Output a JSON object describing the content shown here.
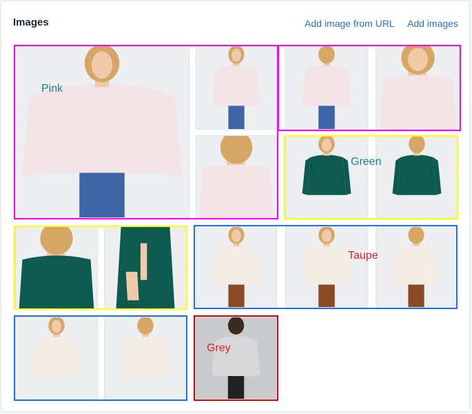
{
  "header": {
    "title": "Images",
    "add_from_url": "Add image from URL",
    "add_images": "Add images"
  },
  "groups": {
    "pink": {
      "label": "Pink",
      "label_color": "#1a7f8a",
      "border_color": "#ff00ff"
    },
    "green": {
      "label": "Green",
      "label_color": "#1a7f8a",
      "border_color": "#ffff00"
    },
    "taupe": {
      "label": "Taupe",
      "label_color": "#e02020",
      "border_color": "#1a73e8"
    },
    "grey": {
      "label": "Grey",
      "label_color": "#e02020",
      "border_color": "#e00000"
    }
  },
  "colors": {
    "pink_top": "#f1e3e6",
    "green_top": "#0d5b4f",
    "taupe_top": "#f3ede6",
    "grey_top": "#d8d8d8",
    "jeans": "#3d66a8",
    "brown_pants": "#8a4b24",
    "black_pants": "#222222",
    "skin": "#f0c9a8",
    "hair_blonde": "#d6a664",
    "hair_dark": "#3a2a22",
    "background_light": "#eceef0",
    "background_grey": "#c9cacc"
  }
}
